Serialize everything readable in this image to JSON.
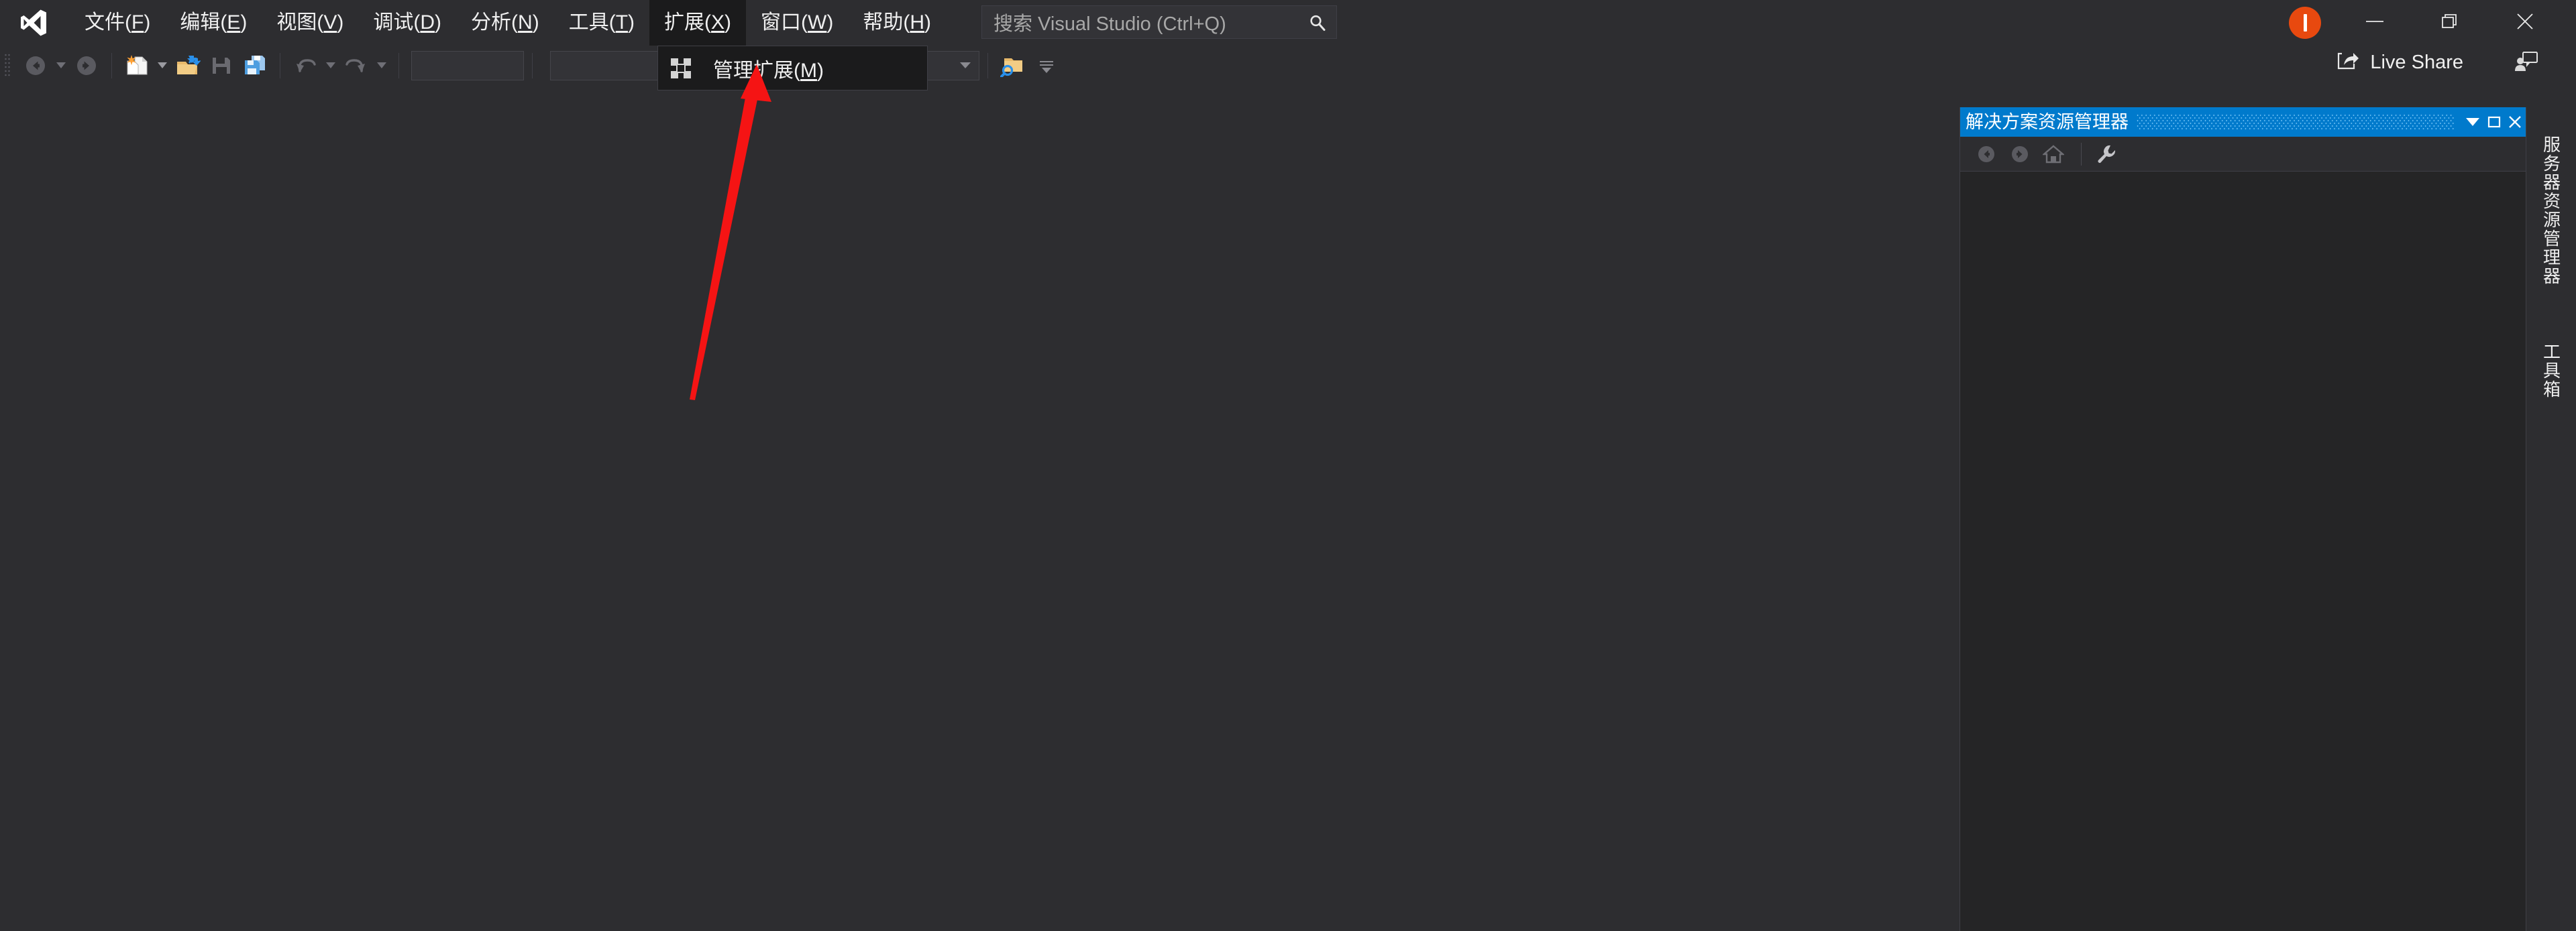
{
  "app": {
    "name": "Visual Studio",
    "logo_icon": "visual-studio-logo-icon",
    "background_color": "#2d2d30",
    "accent_color": "#007acc"
  },
  "menubar": {
    "items": [
      {
        "label": "文件(F)",
        "text": "文件(",
        "mnemonic": "F",
        "tail": ")",
        "active": false
      },
      {
        "label": "编辑(E)",
        "text": "编辑(",
        "mnemonic": "E",
        "tail": ")",
        "active": false
      },
      {
        "label": "视图(V)",
        "text": "视图(",
        "mnemonic": "V",
        "tail": ")",
        "active": false
      },
      {
        "label": "调试(D)",
        "text": "调试(",
        "mnemonic": "D",
        "tail": ")",
        "active": false
      },
      {
        "label": "分析(N)",
        "text": "分析(",
        "mnemonic": "N",
        "tail": ")",
        "active": false
      },
      {
        "label": "工具(T)",
        "text": "工具(",
        "mnemonic": "T",
        "tail": ")",
        "active": false
      },
      {
        "label": "扩展(X)",
        "text": "扩展(",
        "mnemonic": "X",
        "tail": ")",
        "active": true
      },
      {
        "label": "窗口(W)",
        "text": "窗口(",
        "mnemonic": "W",
        "tail": ")",
        "active": false
      },
      {
        "label": "帮助(H)",
        "text": "帮助(",
        "mnemonic": "H",
        "tail": ")",
        "active": false
      }
    ]
  },
  "search": {
    "placeholder": "搜索 Visual Studio (Ctrl+Q)",
    "value": "",
    "icon": "search-icon"
  },
  "dropdown": {
    "open_for": "扩展(X)",
    "items": [
      {
        "label": "管理扩展(M)",
        "text": "管理扩展(",
        "mnemonic": "M",
        "tail": ")",
        "icon": "manage-extensions-icon"
      }
    ]
  },
  "window_controls": {
    "minimize_icon": "minimize-icon",
    "maximize_icon": "restore-icon",
    "close_icon": "close-icon",
    "avatar": {
      "icon": "user-avatar-icon",
      "color": "#e8490f",
      "initial": "I"
    }
  },
  "liveshare": {
    "label": "Live Share",
    "icon": "live-share-icon",
    "feedback_icon": "send-feedback-icon"
  },
  "toolbar": {
    "grip_icon": "drag-grip-icon",
    "buttons": [
      {
        "name": "navigate-backward-button",
        "icon": "arrow-left-circle-icon",
        "enabled": false,
        "has_caret": true
      },
      {
        "name": "navigate-forward-button",
        "icon": "arrow-right-circle-icon",
        "enabled": false,
        "has_caret": false
      },
      {
        "name": "new-file-button",
        "icon": "new-file-icon",
        "enabled": true,
        "has_caret": true
      },
      {
        "name": "open-file-button",
        "icon": "open-folder-icon",
        "enabled": true,
        "has_caret": false
      },
      {
        "name": "save-button",
        "icon": "save-icon",
        "enabled": false,
        "has_caret": false
      },
      {
        "name": "save-all-button",
        "icon": "save-all-icon",
        "enabled": true,
        "has_caret": false
      },
      {
        "name": "undo-button",
        "icon": "undo-icon",
        "enabled": false,
        "has_caret": true
      },
      {
        "name": "redo-button",
        "icon": "redo-icon",
        "enabled": false,
        "has_caret": true
      }
    ],
    "combos": [
      {
        "name": "solution-configuration-combo",
        "value": "",
        "has_caret": false
      },
      {
        "name": "solution-platform-combo",
        "value": "",
        "has_caret": true
      },
      {
        "name": "start-debug-target-combo",
        "value": "",
        "has_caret": true
      }
    ],
    "find_in_files": {
      "name": "find-in-files-button",
      "icon": "folder-search-icon"
    },
    "overflow": {
      "name": "toolbar-overflow-button",
      "icon": "toolbar-overflow-icon"
    }
  },
  "solution_explorer": {
    "title": "解决方案资源管理器",
    "title_bar_color": "#007acc",
    "title_buttons": [
      {
        "name": "panel-menu-button",
        "icon": "chevron-down-icon"
      },
      {
        "name": "panel-maximize-button",
        "icon": "maximize-square-icon"
      },
      {
        "name": "panel-close-button",
        "icon": "close-icon"
      }
    ],
    "toolbar_buttons": [
      {
        "name": "se-back-button",
        "icon": "arrow-left-circle-icon",
        "enabled": false
      },
      {
        "name": "se-forward-button",
        "icon": "arrow-right-circle-icon",
        "enabled": false
      },
      {
        "name": "se-home-button",
        "icon": "home-icon",
        "enabled": false
      },
      {
        "name": "se-properties-button",
        "icon": "wrench-icon",
        "enabled": true
      }
    ],
    "tree_items": []
  },
  "vertical_tabs": [
    {
      "name": "sidebar-tab-server-explorer",
      "label": "服务器资源管理器"
    },
    {
      "name": "sidebar-tab-toolbox",
      "label": "工具箱"
    }
  ],
  "annotation": {
    "type": "arrow",
    "color": "#f01010",
    "points_to": "管理扩展(M)"
  }
}
